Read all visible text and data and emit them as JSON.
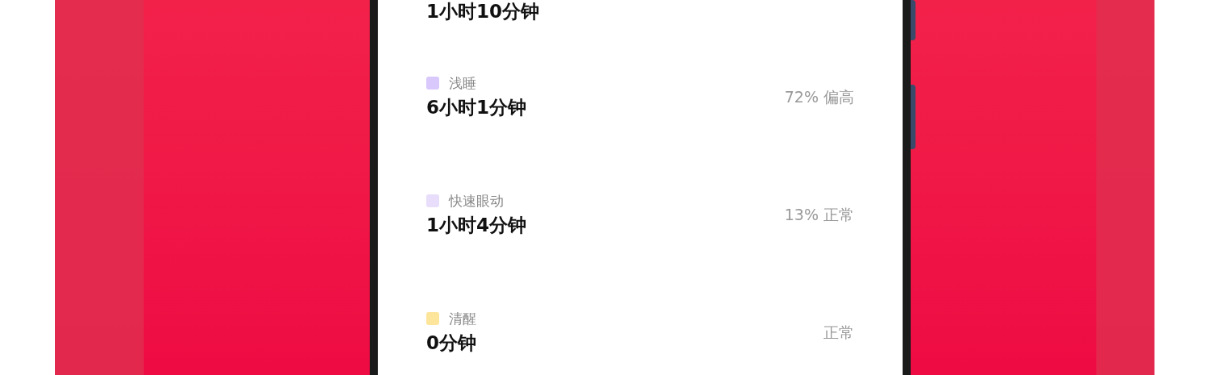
{
  "sleep_stages": [
    {
      "value": "1小时10分钟"
    },
    {
      "label": "浅睡",
      "value": "6小时1分钟",
      "note": "72% 偏高",
      "color": "#d8c8fb"
    },
    {
      "label": "快速眼动",
      "value": "1小时4分钟",
      "note": "13% 正常",
      "color": "#e8defb"
    },
    {
      "label": "清醒",
      "value": "0分钟",
      "note": "正常",
      "color": "#fde69c"
    }
  ]
}
